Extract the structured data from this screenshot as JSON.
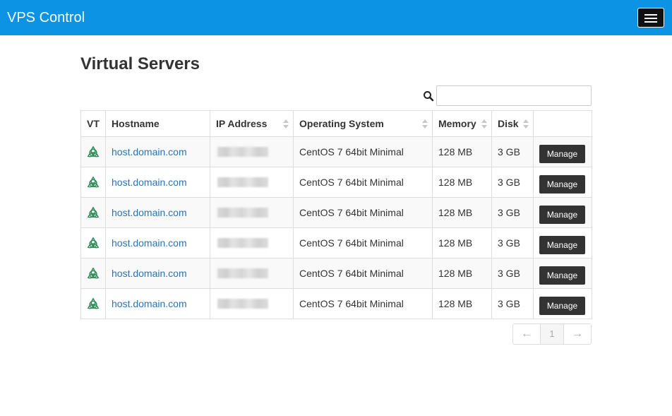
{
  "app": {
    "title": "VPS Control"
  },
  "page": {
    "title": "Virtual Servers"
  },
  "search": {
    "placeholder": "",
    "value": ""
  },
  "table": {
    "columns": [
      "VT",
      "Hostname",
      "IP Address",
      "Operating System",
      "Memory",
      "Disk",
      ""
    ],
    "rows": [
      {
        "hostname": "host.domain.com",
        "os": "CentOS 7 64bit Minimal",
        "memory": "128 MB",
        "disk": "3 GB",
        "action": "Manage"
      },
      {
        "hostname": "host.domain.com",
        "os": "CentOS 7 64bit Minimal",
        "memory": "128 MB",
        "disk": "3 GB",
        "action": "Manage"
      },
      {
        "hostname": "host.domain.com",
        "os": "CentOS 7 64bit Minimal",
        "memory": "128 MB",
        "disk": "3 GB",
        "action": "Manage"
      },
      {
        "hostname": "host.domain.com",
        "os": "CentOS 7 64bit Minimal",
        "memory": "128 MB",
        "disk": "3 GB",
        "action": "Manage"
      },
      {
        "hostname": "host.domain.com",
        "os": "CentOS 7 64bit Minimal",
        "memory": "128 MB",
        "disk": "3 GB",
        "action": "Manage"
      },
      {
        "hostname": "host.domain.com",
        "os": "CentOS 7 64bit Minimal",
        "memory": "128 MB",
        "disk": "3 GB",
        "action": "Manage"
      }
    ]
  },
  "pagination": {
    "prev": "←",
    "current": "1",
    "next": "→"
  },
  "icons": {
    "vt": "openvz-triquetra-icon",
    "search": "search-icon",
    "menu": "hamburger-menu-icon"
  },
  "colors": {
    "navbar": "#0d93e4",
    "button": "#333333",
    "link": "#2a73b6",
    "vt_icon": "#2e8b57"
  }
}
